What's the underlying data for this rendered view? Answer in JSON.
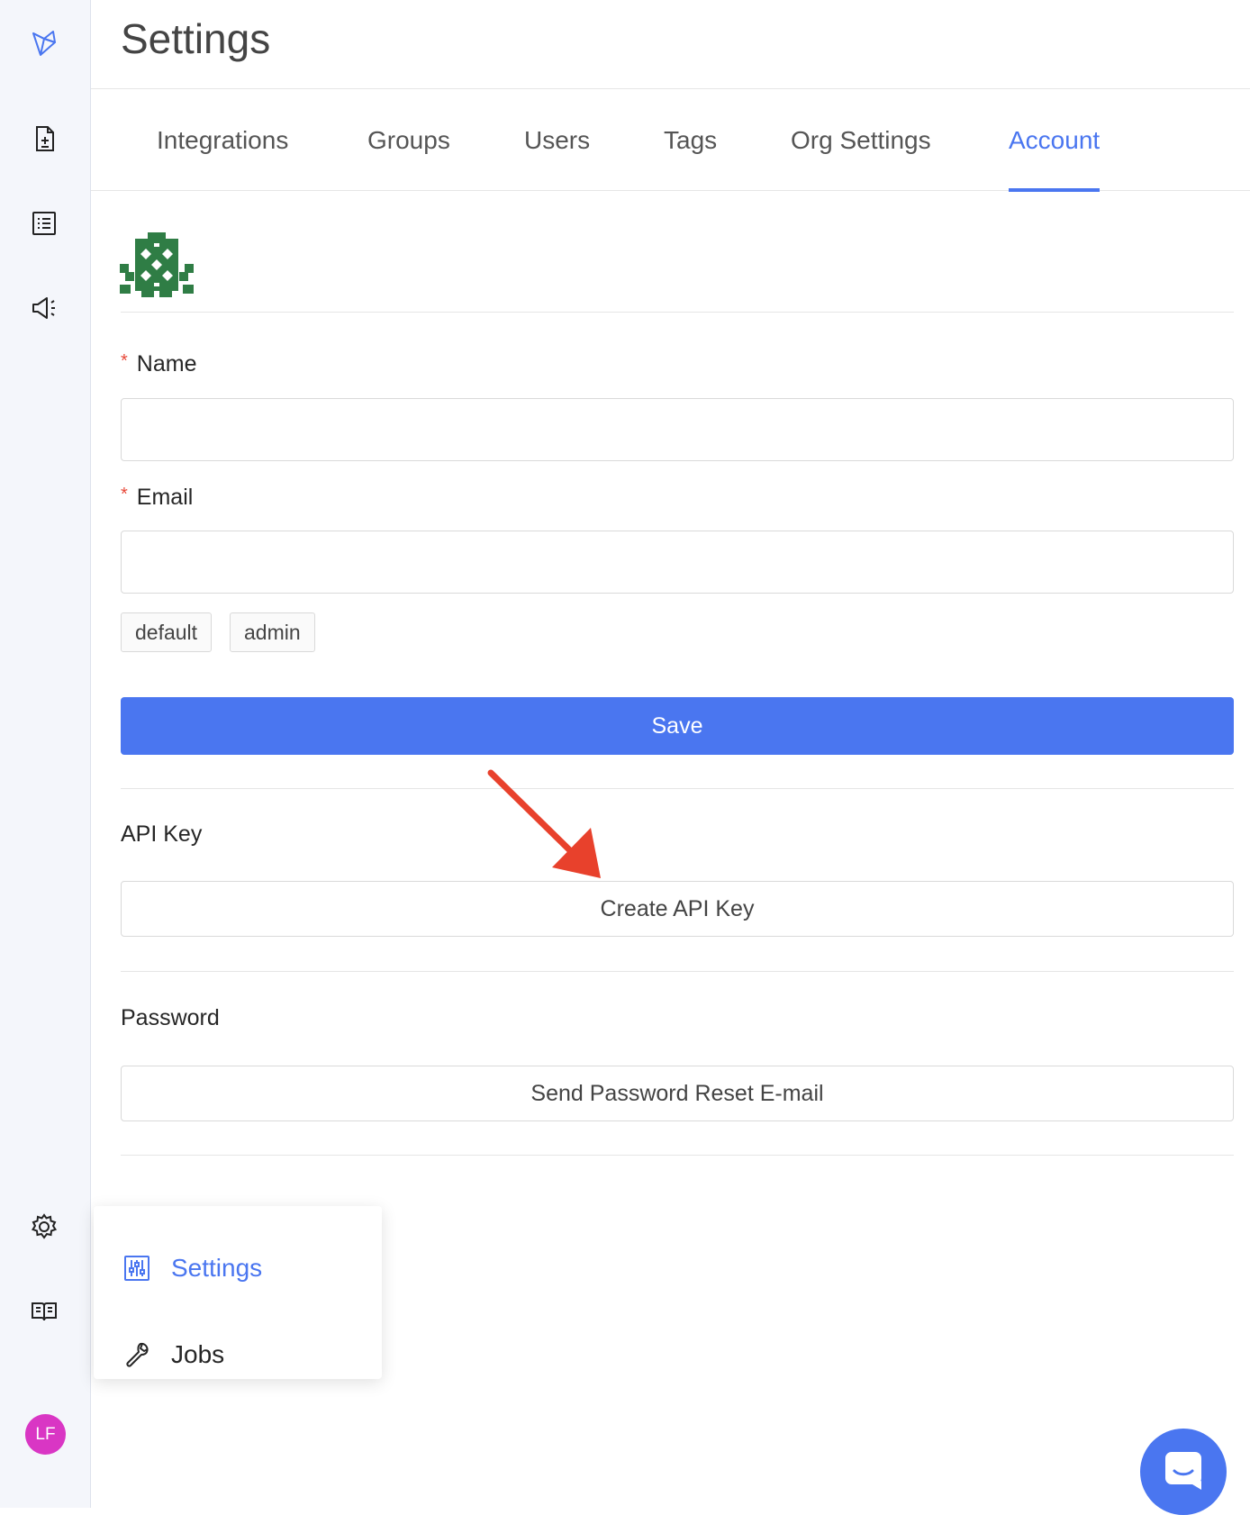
{
  "page": {
    "title": "Settings"
  },
  "sidebar": {
    "icons": [
      "logo-icon",
      "document-add-icon",
      "list-icon",
      "megaphone-icon",
      "gear-icon",
      "book-icon"
    ],
    "avatar_initials": "LF"
  },
  "tabs": [
    {
      "label": "Integrations",
      "active": false
    },
    {
      "label": "Groups",
      "active": false
    },
    {
      "label": "Users",
      "active": false
    },
    {
      "label": "Tags",
      "active": false
    },
    {
      "label": "Org Settings",
      "active": false
    },
    {
      "label": "Account",
      "active": true
    }
  ],
  "form": {
    "name": {
      "label": "Name",
      "required_mark": "*",
      "value": ""
    },
    "email": {
      "label": "Email",
      "required_mark": "*",
      "value": ""
    },
    "tags": [
      "default",
      "admin"
    ],
    "save_label": "Save"
  },
  "api_key": {
    "label": "API Key",
    "button_label": "Create API Key"
  },
  "password": {
    "label": "Password",
    "button_label": "Send Password Reset E-mail"
  },
  "popup_menu": {
    "items": [
      {
        "label": "Settings",
        "icon": "sliders-icon",
        "active": true
      },
      {
        "label": "Jobs",
        "icon": "wrench-icon",
        "active": false
      }
    ]
  },
  "colors": {
    "accent": "#4a76f0",
    "required": "#e8493a",
    "avatar": "#d936c4",
    "annotation_arrow": "#e8412c"
  },
  "chat_widget": {
    "icon": "chat-icon"
  }
}
